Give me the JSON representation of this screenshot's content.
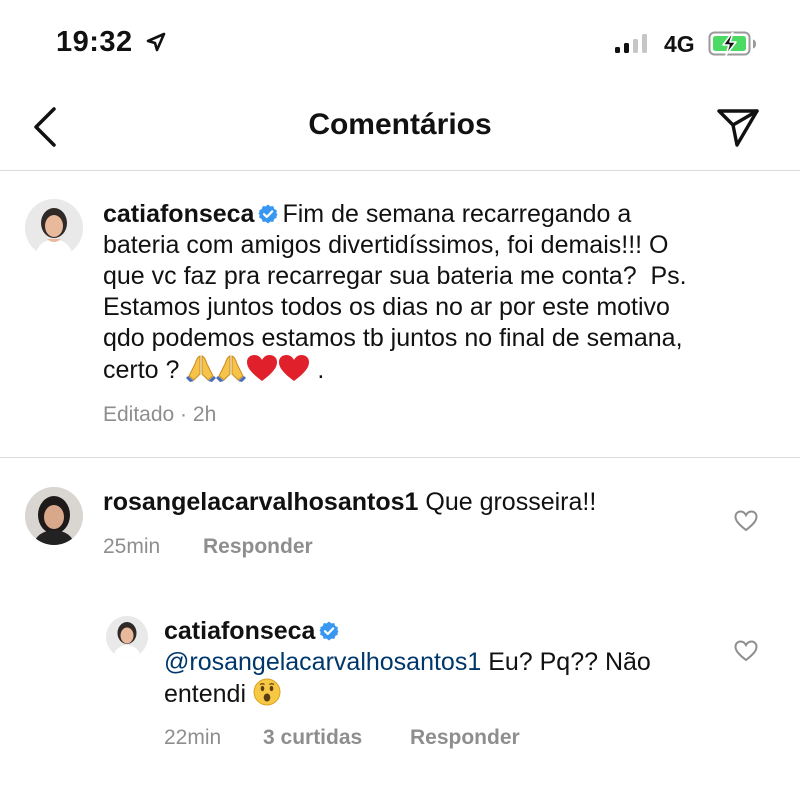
{
  "status_bar": {
    "time": "19:32",
    "network": "4G"
  },
  "header": {
    "title": "Comentários"
  },
  "caption": {
    "username": "catiafonseca",
    "text_line1": "Fim de semana recarregando a",
    "text_line2": "bateria com amigos divertidíssimos, foi demais!!! O",
    "text_line3": "que vc faz pra recarregar sua bateria me conta?  Ps.",
    "text_line4": "Estamos juntos todos os dias no ar por este motivo",
    "text_line5": "qdo podemos estamos tb juntos no final de semana,",
    "text_line6": "certo ?",
    "text_end": ".",
    "emojis": [
      "pray-emoji",
      "pray-emoji",
      "heart-emoji",
      "heart-emoji"
    ],
    "edited": "Editado · 2h"
  },
  "comments": [
    {
      "username": "rosangelacarvalhosantos1",
      "text": "Que grosseira!!",
      "time": "25min",
      "reply_label": "Responder"
    }
  ],
  "replies": [
    {
      "username": "catiafonseca",
      "mention": "@rosangelacarvalhosantos1",
      "text_line1": "Eu? Pq?? Não",
      "text_line2": "entendi",
      "emoji": "hushed-face-emoji",
      "time": "22min",
      "likes": "3 curtidas",
      "reply_label": "Responder"
    }
  ],
  "colors": {
    "verified": "#3897f0",
    "mention": "#00376b",
    "meta": "#8e8e8e",
    "heart": "#e0202a",
    "battery": "#4cd964"
  }
}
